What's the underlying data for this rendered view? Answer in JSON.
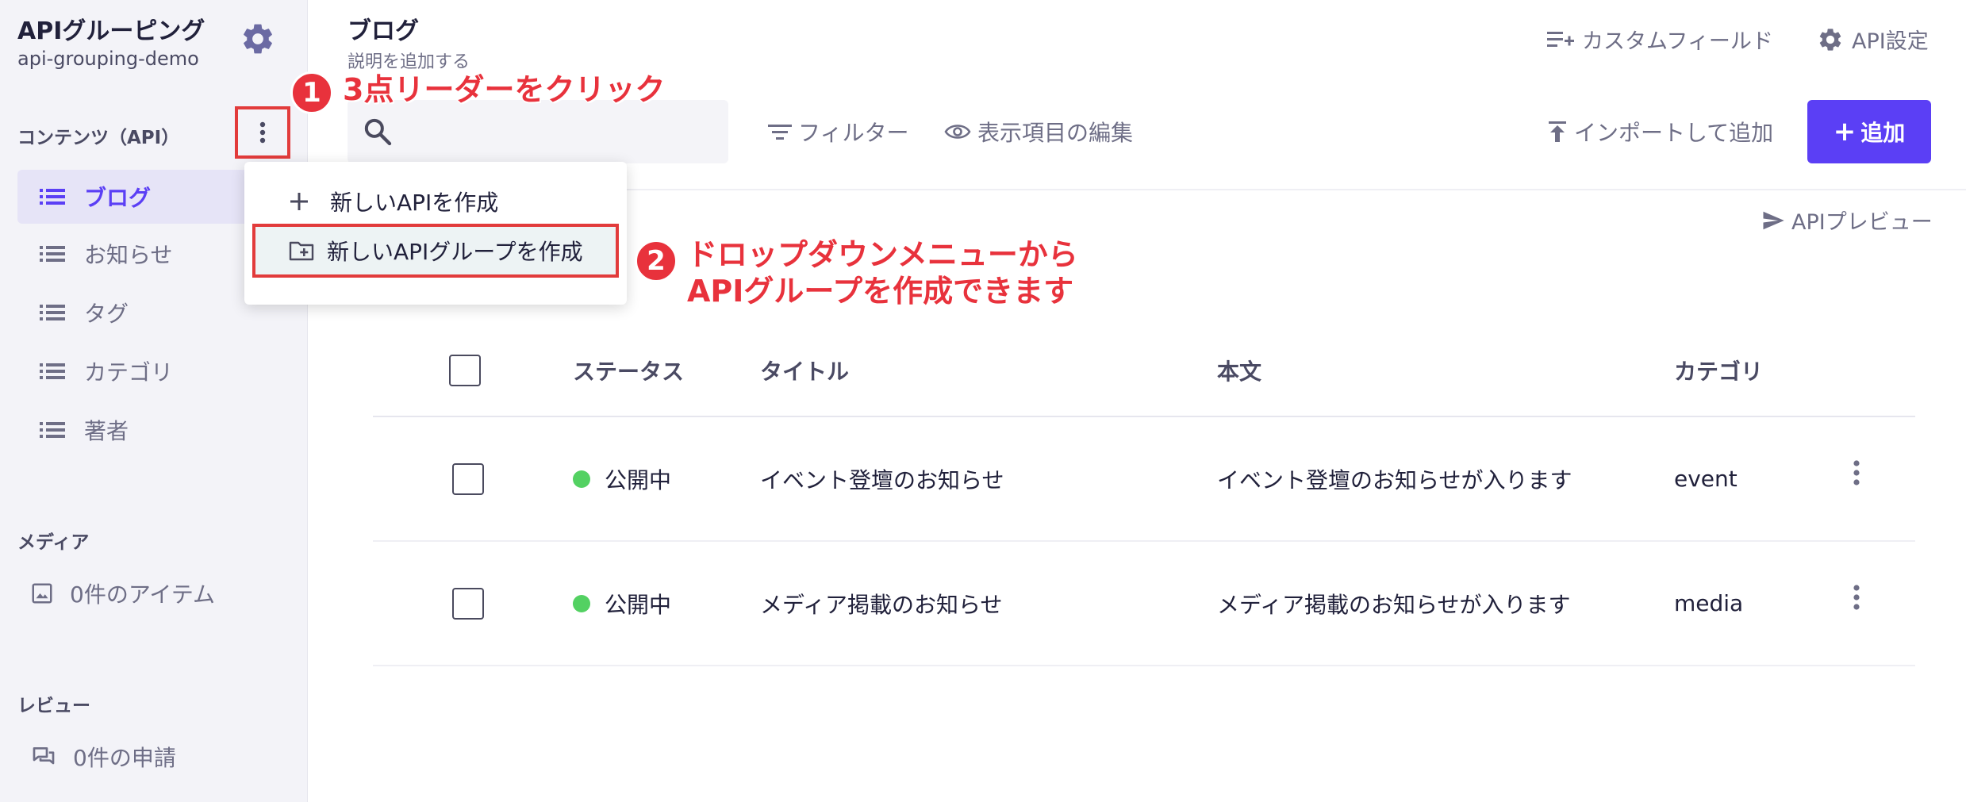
{
  "sidebar": {
    "app_title": "APIグルーピング",
    "app_subtitle": "api-grouping-demo",
    "content_section_label": "コンテンツ（API）",
    "items": [
      {
        "label": "ブログ",
        "active": true
      },
      {
        "label": "お知らせ"
      },
      {
        "label": "タグ"
      },
      {
        "label": "カテゴリ"
      },
      {
        "label": "著者"
      }
    ],
    "media_section_label": "メディア",
    "media_count_label": "0件のアイテム",
    "review_section_label": "レビュー",
    "review_count_label": "0件の申請"
  },
  "header": {
    "title": "ブログ",
    "description": "説明を追加する",
    "custom_fields_label": "カスタムフィールド",
    "api_settings_label": "API設定"
  },
  "toolbar": {
    "search_placeholder": "",
    "filter_label": "フィルター",
    "edit_columns_label": "表示項目の編集",
    "import_label": "インポートして追加",
    "add_label": "追加",
    "api_preview_label": "APIプレビュー"
  },
  "dropdown": {
    "items": [
      {
        "label": "新しいAPIを作成",
        "icon": "plus-icon"
      },
      {
        "label": "新しいAPIグループを作成",
        "icon": "folder-add-icon"
      }
    ]
  },
  "table": {
    "columns": [
      "ステータス",
      "タイトル",
      "本文",
      "カテゴリ"
    ],
    "rows": [
      {
        "status": "公開中",
        "title": "イベント登壇のお知らせ",
        "body": "イベント登壇のお知らせが入ります",
        "category": "event"
      },
      {
        "status": "公開中",
        "title": "メディア掲載のお知らせ",
        "body": "メディア掲載のお知らせが入ります",
        "category": "media"
      }
    ]
  },
  "annotations": {
    "step1_number": "1",
    "step1_text": "3点リーダーをクリック",
    "step2_number": "2",
    "step2_line1": "ドロップダウンメニューから",
    "step2_line2": "APIグループを作成できます"
  },
  "colors": {
    "accent": "#5b3ff5",
    "annotation_red": "#e8323c",
    "status_published": "#53d162",
    "sidebar_bg": "#f3f3f8"
  }
}
